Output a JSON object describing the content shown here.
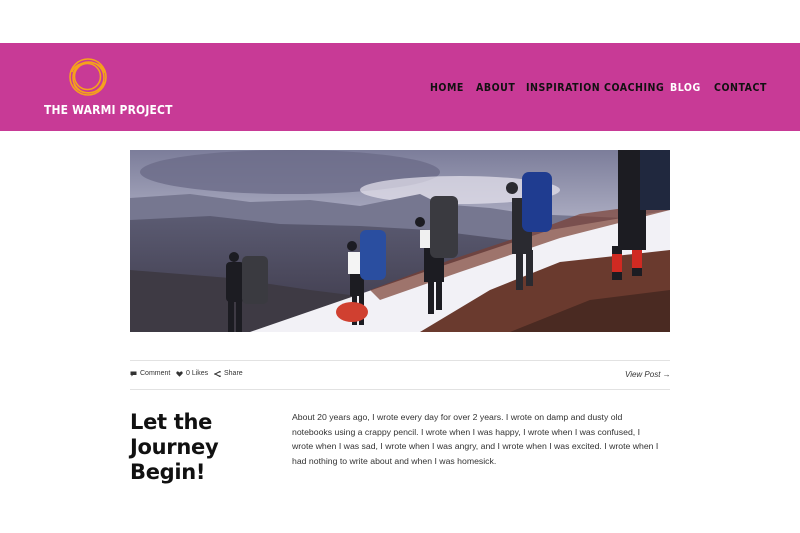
{
  "site": {
    "logo_text": "THE WARMI PROJECT",
    "brand_color": "#c83a96",
    "logo_color": "#f5a21c"
  },
  "nav": {
    "items": [
      {
        "label": "HOME",
        "active": false
      },
      {
        "label": "ABOUT",
        "active": false
      },
      {
        "label": "INSPIRATION",
        "active": false
      },
      {
        "label": "COACHING",
        "active": false
      },
      {
        "label": "BLOG",
        "active": true
      },
      {
        "label": "CONTACT",
        "active": false
      }
    ]
  },
  "post": {
    "hero_image": "photo of backpackers hiking up a snowy mountain slope",
    "meta": {
      "comment_label": "Comment",
      "likes_label": "0 Likes",
      "share_label": "Share",
      "comment_icon": "speech-bubble-icon",
      "likes_icon": "heart-icon",
      "share_icon": "share-icon"
    },
    "view_post_label": "View Post →",
    "title_lines": [
      "Let the",
      "Journey",
      "Begin!"
    ],
    "body_lines": [
      "About 20 years ago, I wrote every day for over 2 years. I wrote on damp and dusty old",
      "notebooks using a crappy pencil. I wrote when I was happy, I wrote when I was confused, I",
      "wrote when I was sad, I wrote when I was angry, and I wrote when I was excited. I wrote when I",
      "had nothing to write about and when I was homesick."
    ]
  }
}
